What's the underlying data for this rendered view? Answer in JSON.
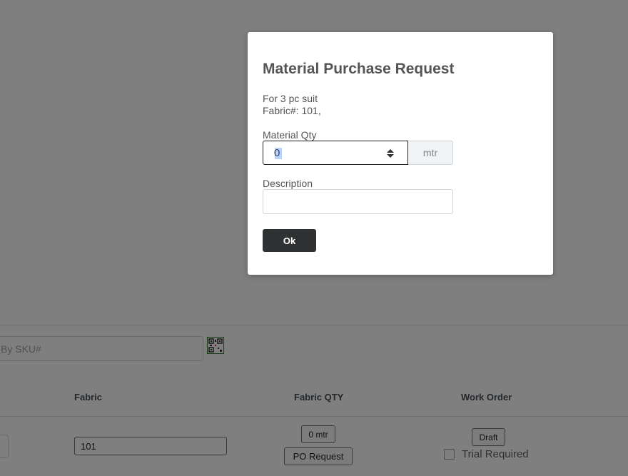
{
  "background": {
    "search": {
      "placeholder": "By SKU#"
    },
    "table": {
      "headers": {
        "fabric": "Fabric",
        "fabric_qty": "Fabric QTY",
        "work_order": "Work Order"
      },
      "row": {
        "fabric_value": "101",
        "fabric_qty_button": "0 mtr",
        "po_request_button": "PO Request",
        "draft_button": "Draft",
        "trial_required_label": "Trial Required",
        "trial_required_checked": false
      }
    }
  },
  "modal": {
    "title": "Material Purchase Request",
    "subtitle_line1": "For 3 pc suit",
    "subtitle_line2": "Fabric#: 101,",
    "qty_label": "Material Qty",
    "qty_value": "0",
    "qty_unit": "mtr",
    "description_label": "Description",
    "description_value": "",
    "ok_button": "Ok"
  },
  "colors": {
    "overlay": "#808080",
    "ok_button_bg": "#2f3133",
    "title_text": "#555555"
  },
  "icons": [
    "qr-code-icon",
    "spinner-arrows-icon"
  ]
}
